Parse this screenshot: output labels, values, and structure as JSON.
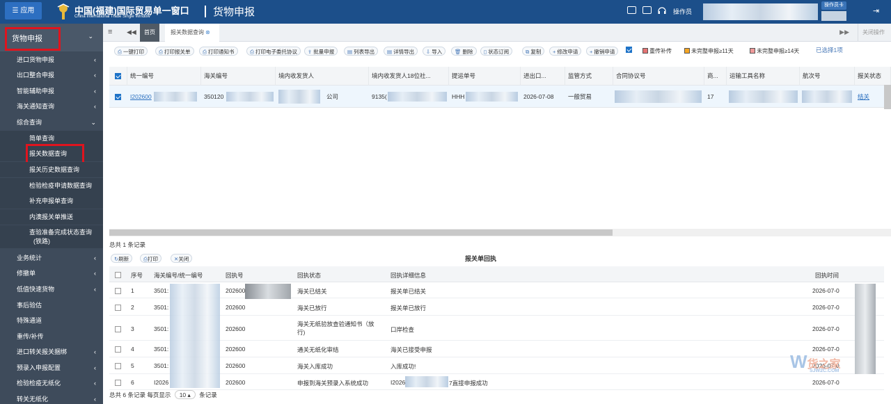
{
  "topbar": {
    "app_button": "☰ 应用",
    "brand_cn": "中国(福建)国际贸易单一窗口",
    "brand_en": "China International Trade Single Window",
    "module_title": "货物申报",
    "operator_label": "操作员",
    "operator_card": "操作员卡"
  },
  "sidebar": {
    "header": "货物申报",
    "items": [
      {
        "label": "进口货物申报",
        "arrow": "‹"
      },
      {
        "label": "出口整合申报",
        "arrow": "‹"
      },
      {
        "label": "智能辅助申报",
        "arrow": "‹"
      },
      {
        "label": "海关通知查询",
        "arrow": "‹"
      },
      {
        "label": "综合查询",
        "arrow": "⌄"
      }
    ],
    "sub_items": [
      "简单查询",
      "报关数据查询",
      "报关历史数据查询",
      "检验检疫申请数据查询",
      "补充申报单查询",
      "内澳报关单推送",
      "查验准备完成状态查询",
      "(铁路)"
    ],
    "items_bottom": [
      {
        "label": "业务统计",
        "arrow": "‹"
      },
      {
        "label": "修撤单",
        "arrow": "‹"
      },
      {
        "label": "低值快速货物",
        "arrow": "‹"
      },
      {
        "label": "事后验估",
        "arrow": ""
      },
      {
        "label": "特殊通道",
        "arrow": ""
      },
      {
        "label": "重传/补传",
        "arrow": ""
      },
      {
        "label": "进口转关报关捆绑",
        "arrow": "‹"
      },
      {
        "label": "预录入申报配置",
        "arrow": "‹"
      },
      {
        "label": "检验检疫无纸化",
        "arrow": "‹"
      },
      {
        "label": "转关无纸化",
        "arrow": "‹"
      }
    ]
  },
  "tabs": {
    "home": "首页",
    "active": "报关数据查询",
    "close_ops": "关闭操作"
  },
  "toolbar": {
    "buttons": [
      "一键打印",
      "打印报关单",
      "打印通知书",
      "打印电子委托协议",
      "批量申报",
      "列表导出",
      "详情导出",
      "导入",
      "删除",
      "状态订阅",
      "复制",
      "修改申请",
      "撤销申请"
    ],
    "legend": [
      "重传补传",
      "未完整申报≥11天",
      "未完整申报≥14天"
    ],
    "legend_colors": [
      "#e57373",
      "#f5a623",
      "#ef9a9a"
    ],
    "selected": "已选择1项"
  },
  "grid": {
    "headers": [
      "统一编号",
      "海关编号",
      "境内收发货人",
      "境内收发货人18位社...",
      "提运单号",
      "进出口...",
      "监管方式",
      "合同协议号",
      "商...",
      "运输工具名称",
      "航次号",
      "报关状态"
    ],
    "row": [
      "I202600",
      "350120",
      "公司",
      "9135(",
      "HHH",
      "2026-07-08",
      "一般贸易",
      "",
      "17",
      "",
      "",
      "结关"
    ],
    "total": "总共 1 条记录"
  },
  "receipt": {
    "buttons": [
      "刷新",
      "打印",
      "关闭"
    ],
    "title": "报关单回执",
    "headers": [
      "序号",
      "海关编号/统一编号",
      "回执号",
      "回执状态",
      "回执详细信息",
      "回执时间"
    ],
    "rows": [
      [
        "1",
        "3501:",
        "202600",
        "海关已结关",
        "报关单已结关",
        "2026-07-0"
      ],
      [
        "2",
        "3501:",
        "202600",
        "海关已放行",
        "报关单已放行",
        "2026-07-0"
      ],
      [
        "3",
        "3501:",
        "202600",
        "海关无纸验放查验通知书（放行)",
        "口岸检查",
        "2026-07-0"
      ],
      [
        "4",
        "3501:",
        "202600",
        "通关无纸化审结",
        "海关已接受申报",
        "2026-07-0"
      ],
      [
        "5",
        "3501:",
        "202600",
        "海关入库成功",
        "入库成功!",
        "2026-07-0"
      ],
      [
        "6",
        "I2026",
        "202600",
        "申报到海关预录入系统成功",
        "I2026",
        "2026-07-0"
      ]
    ],
    "row6_extra": "7直接申报成功"
  },
  "footer": {
    "prefix": "总共 6 条记录 每页显示",
    "page_size": "10",
    "suffix": "条记录"
  },
  "watermark": {
    "text": "货之家",
    "sub": "SJW2C.COM"
  }
}
